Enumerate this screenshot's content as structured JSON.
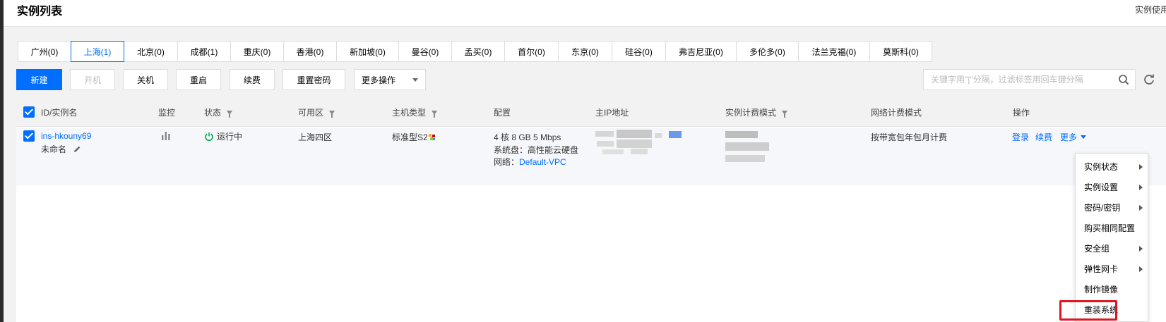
{
  "header": {
    "title": "实例列表",
    "right_text": "实例使用"
  },
  "regions": [
    {
      "label": "广州(0)",
      "active": false
    },
    {
      "label": "上海(1)",
      "active": true
    },
    {
      "label": "北京(0)",
      "active": false
    },
    {
      "label": "成都(1)",
      "active": false
    },
    {
      "label": "重庆(0)",
      "active": false
    },
    {
      "label": "香港(0)",
      "active": false
    },
    {
      "label": "新加坡(0)",
      "active": false
    },
    {
      "label": "曼谷(0)",
      "active": false
    },
    {
      "label": "孟买(0)",
      "active": false
    },
    {
      "label": "首尔(0)",
      "active": false
    },
    {
      "label": "东京(0)",
      "active": false
    },
    {
      "label": "硅谷(0)",
      "active": false
    },
    {
      "label": "弗吉尼亚(0)",
      "active": false
    },
    {
      "label": "多伦多(0)",
      "active": false
    },
    {
      "label": "法兰克福(0)",
      "active": false
    },
    {
      "label": "莫斯科(0)",
      "active": false
    }
  ],
  "toolbar": {
    "new_label": "新建",
    "start_label": "开机",
    "shutdown_label": "关机",
    "restart_label": "重启",
    "renew_label": "续费",
    "reset_password_label": "重置密码",
    "more_actions_label": "更多操作"
  },
  "search": {
    "placeholder": "关键字用\"|\"分隔，过滤标签用回车键分隔"
  },
  "table": {
    "columns": {
      "id_name": "ID/实例名",
      "monitor": "监控",
      "status": "状态",
      "zone": "可用区",
      "host_type": "主机类型",
      "config": "配置",
      "primary_ip": "主IP地址",
      "billing_mode": "实例计费模式",
      "network_billing": "网络计费模式",
      "actions": "操作"
    },
    "row": {
      "instance_id": "ins-hkouny69",
      "instance_name": "未命名",
      "status": "运行中",
      "zone": "上海四区",
      "host_type": "标准型S2",
      "config_line1": "4 核 8 GB 5 Mbps",
      "config_line2": "系统盘：高性能云硬盘",
      "config_network_label": "网络：",
      "config_network_value": "Default-VPC",
      "network_billing": "按带宽包年包月计费",
      "action_login": "登录",
      "action_renew": "续费",
      "action_more": "更多"
    }
  },
  "more_menu": [
    {
      "label": "实例状态",
      "submenu": true
    },
    {
      "label": "实例设置",
      "submenu": true
    },
    {
      "label": "密码/密钥",
      "submenu": true
    },
    {
      "label": "购买相同配置",
      "submenu": false
    },
    {
      "label": "安全组",
      "submenu": true
    },
    {
      "label": "弹性网卡",
      "submenu": true
    },
    {
      "label": "制作镜像",
      "submenu": false
    },
    {
      "label": "重装系统",
      "submenu": false,
      "highlighted": true
    }
  ],
  "colors": {
    "accent": "#006eff",
    "running": "#00a84f",
    "highlight": "#e0161f"
  }
}
